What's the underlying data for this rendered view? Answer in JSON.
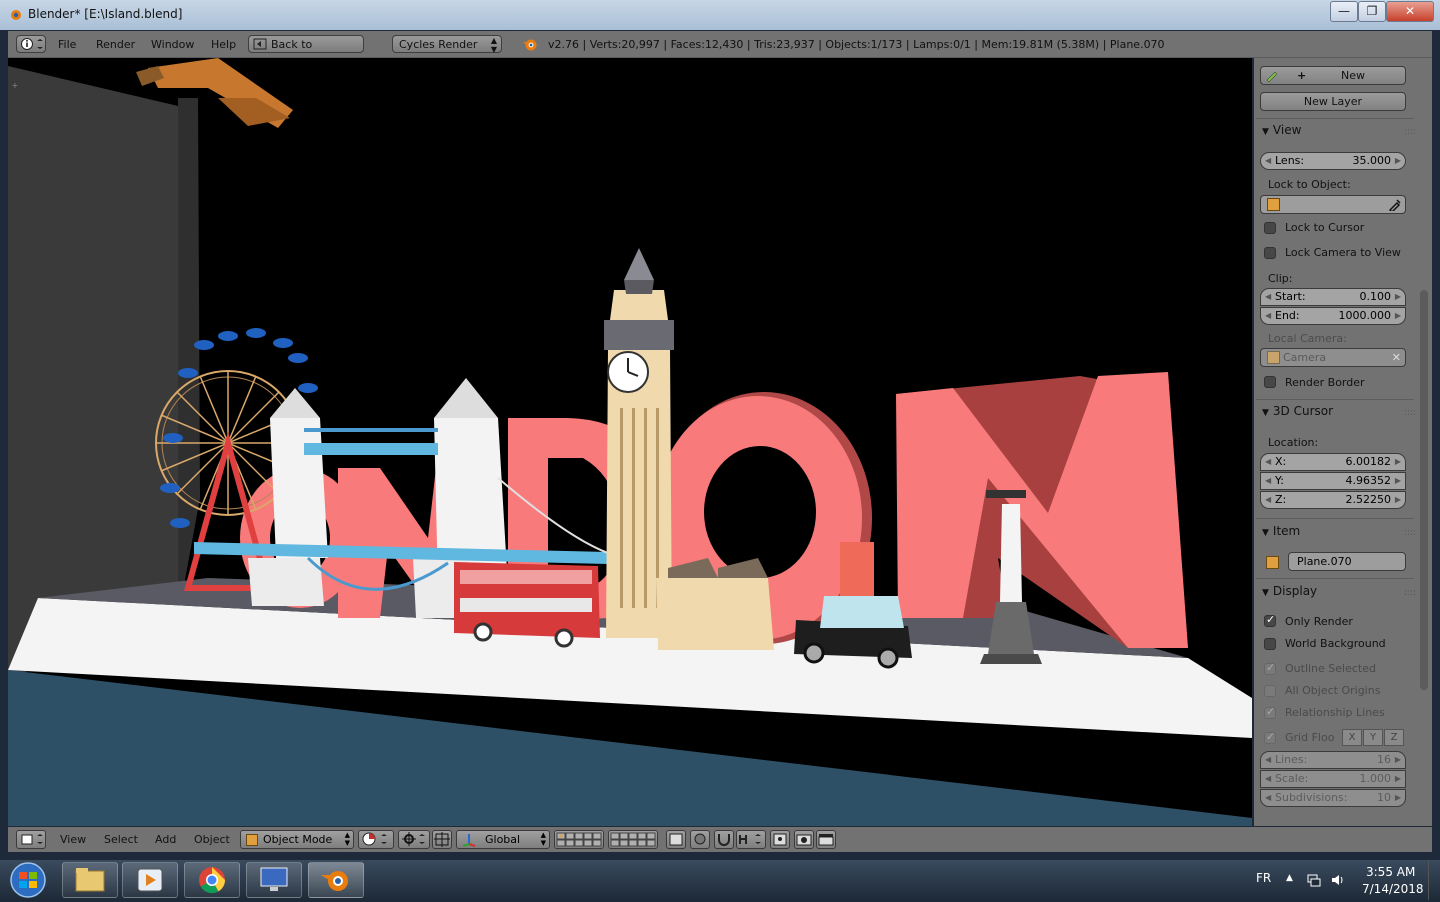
{
  "window": {
    "title": "Blender* [E:\\Island.blend]",
    "buttons": [
      "—",
      "❐",
      "✕"
    ]
  },
  "info_header": {
    "menus": [
      "File",
      "Render",
      "Window",
      "Help"
    ],
    "back_button": "Back to Previous",
    "render_engine": "Cycles Render",
    "stats": "v2.76 | Verts:20,997 | Faces:12,430 | Tris:23,937 | Objects:1/173 | Lamps:0/1 | Mem:19.81M (5.38M) | Plane.070"
  },
  "scene": {
    "letters": "ONDON",
    "note_colors": {
      "letters": "#f87a7a",
      "bus": "#d73a3a",
      "platform": "#f6f6f6",
      "water": "#2e5066"
    }
  },
  "properties": {
    "new_button": "New",
    "new_layer_button": "New Layer",
    "view": {
      "header": "View",
      "lens_label": "Lens:",
      "lens_value": "35.000",
      "lock_to_object_label": "Lock to Object:",
      "lock_to_cursor": "Lock to Cursor",
      "lock_camera_to_view": "Lock Camera to View",
      "clip_label": "Clip:",
      "clip_start_label": "Start:",
      "clip_start_value": "0.100",
      "clip_end_label": "End:",
      "clip_end_value": "1000.000",
      "local_camera_label": "Local Camera:",
      "local_camera_value": "Camera",
      "render_border": "Render Border"
    },
    "cursor": {
      "header": "3D Cursor",
      "location_label": "Location:",
      "x_label": "X:",
      "x_value": "6.00182",
      "y_label": "Y:",
      "y_value": "4.96352",
      "z_label": "Z:",
      "z_value": "2.52250"
    },
    "item": {
      "header": "Item",
      "name": "Plane.070"
    },
    "display": {
      "header": "Display",
      "only_render": "Only Render",
      "world_background": "World Background",
      "outline_selected": "Outline Selected",
      "all_object_origins": "All Object Origins",
      "relationship_lines": "Relationship Lines",
      "grid_floor": "Grid Floo",
      "axis_x": "X",
      "axis_y": "Y",
      "axis_z": "Z",
      "lines_label": "Lines:",
      "lines_value": "16",
      "scale_label": "Scale:",
      "scale_value": "1.000",
      "subdivisions_label": "Subdivisions:",
      "subdivisions_value": "10"
    }
  },
  "view_header": {
    "menus": [
      "View",
      "Select",
      "Add",
      "Object"
    ],
    "mode": "Object Mode",
    "orientation": "Global"
  },
  "taskbar": {
    "language": "FR",
    "time": "3:55 AM",
    "date": "7/14/2018"
  }
}
